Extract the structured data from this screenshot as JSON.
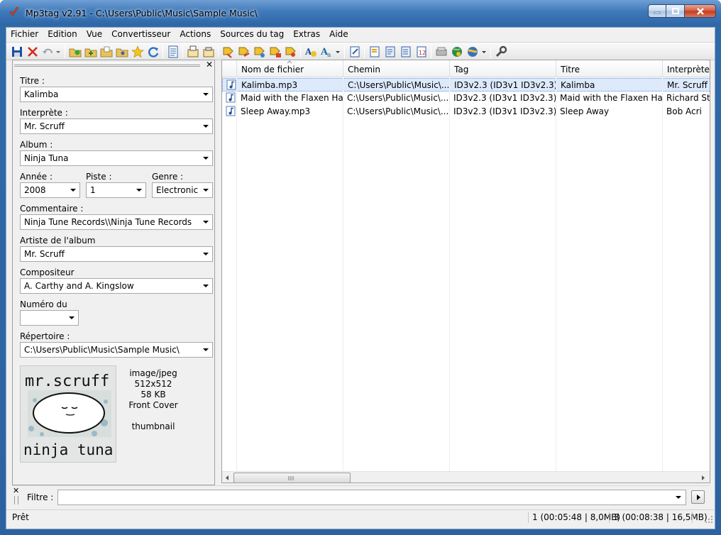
{
  "window": {
    "title": "Mp3tag v2.91  -  C:\\Users\\Public\\Music\\Sample Music\\"
  },
  "menu": [
    "Fichier",
    "Edition",
    "Vue",
    "Convertisseur",
    "Actions",
    "Sources du tag",
    "Extras",
    "Aide"
  ],
  "fields": {
    "title_label": "Titre :",
    "title_value": "Kalimba",
    "artist_label": "Interprète :",
    "artist_value": "Mr. Scruff",
    "album_label": "Album :",
    "album_value": "Ninja Tuna",
    "year_label": "Année :",
    "year_value": "2008",
    "track_label": "Piste :",
    "track_value": "1",
    "genre_label": "Genre :",
    "genre_value": "Electronic",
    "comment_label": "Commentaire :",
    "comment_value": "Ninja Tune Records\\\\Ninja Tune Records",
    "album_artist_label": "Artiste de l'album",
    "album_artist_value": "Mr. Scruff",
    "composer_label": "Compositeur",
    "composer_value": "A. Carthy and A. Kingslow",
    "disc_label": "Numéro du",
    "disc_value": "",
    "directory_label": "Répertoire :",
    "directory_value": "C:\\Users\\Public\\Music\\Sample Music\\"
  },
  "cover": {
    "art_top": "mr.scruff",
    "art_bottom": "ninja tuna",
    "mime": "image/jpeg",
    "dimensions": "512x512",
    "size": "58 KB",
    "type": "Front Cover",
    "description": "thumbnail"
  },
  "columns": [
    "Nom de fichier",
    "Chemin",
    "Tag",
    "Titre",
    "Interprète"
  ],
  "rows": [
    {
      "filename": "Kalimba.mp3",
      "path": "C:\\Users\\Public\\Music\\...",
      "tag": "ID3v2.3 (ID3v1 ID3v2.3)",
      "title": "Kalimba",
      "artist": "Mr. Scruff"
    },
    {
      "filename": "Maid with the Flaxen Ha...",
      "path": "C:\\Users\\Public\\Music\\...",
      "tag": "ID3v2.3 (ID3v1 ID3v2.3)",
      "title": "Maid with the Flaxen Hair",
      "artist": "Richard Sto"
    },
    {
      "filename": "Sleep Away.mp3",
      "path": "C:\\Users\\Public\\Music\\...",
      "tag": "ID3v2.3 (ID3v1 ID3v2.3)",
      "title": "Sleep Away",
      "artist": "Bob Acri"
    }
  ],
  "filter": {
    "label": "Filtre :",
    "value": ""
  },
  "status": {
    "ready": "Prêt",
    "selected": "1 (00:05:48 | 8,0MB)",
    "total": "3 (00:08:38 | 16,5MB)"
  },
  "colors": {
    "accent": "#2f6aa8",
    "selection": "#dceafc"
  }
}
